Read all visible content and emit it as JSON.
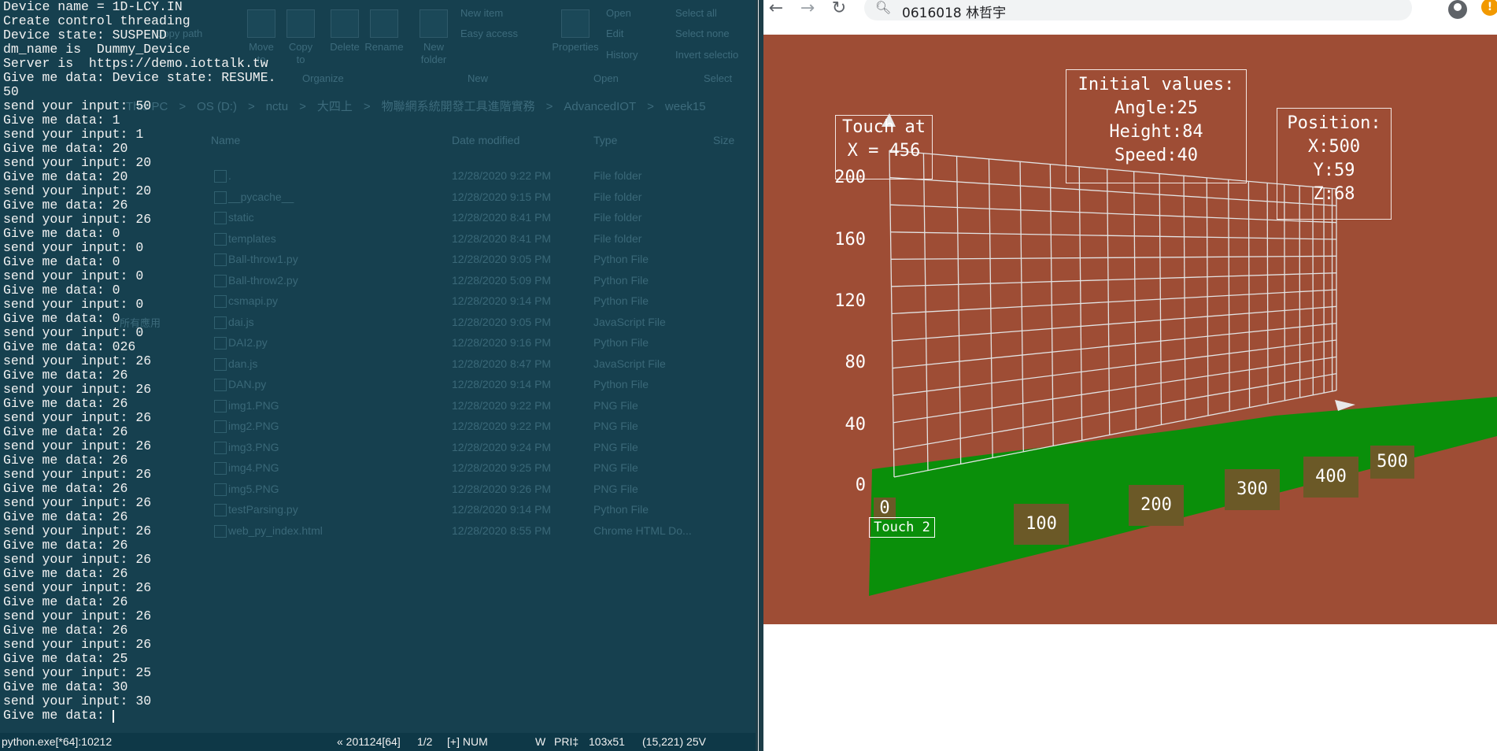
{
  "console": {
    "lines": [
      "Device name = 1D-LCY.IN",
      "Create control threading",
      "Device state: SUSPEND",
      "dm_name is  Dummy_Device",
      "Server is  https://demo.iottalk.tw",
      "Give me data: Device state: RESUME.",
      "50",
      "send your input: 50",
      "Give me data: 1",
      "send your input: 1",
      "Give me data: 20",
      "send your input: 20",
      "Give me data: 20",
      "send your input: 20",
      "Give me data: 26",
      "send your input: 26",
      "Give me data: 0",
      "send your input: 0",
      "Give me data: 0",
      "send your input: 0",
      "Give me data: 0",
      "send your input: 0",
      "Give me data: 0",
      "send your input: 0",
      "Give me data: 026",
      "send your input: 26",
      "Give me data: 26",
      "send your input: 26",
      "Give me data: 26",
      "send your input: 26",
      "Give me data: 26",
      "send your input: 26",
      "Give me data: 26",
      "send your input: 26",
      "Give me data: 26",
      "send your input: 26",
      "Give me data: 26",
      "send your input: 26",
      "Give me data: 26",
      "send your input: 26",
      "Give me data: 26",
      "send your input: 26",
      "Give me data: 26",
      "send your input: 26",
      "Give me data: 26",
      "send your input: 26",
      "Give me data: 25",
      "send your input: 25",
      "Give me data: 30",
      "send your input: 30",
      "Give me data: "
    ],
    "status": {
      "process": "python.exe[*64]:10212",
      "session": "« 201124[64]",
      "tabs": "1/2",
      "mode": "[+] NUM",
      "w": "W",
      "pri": "PRI‡",
      "size": "103x51",
      "cursor": "(15,221) 25V"
    }
  },
  "explorer": {
    "ribbon": {
      "move_to": "Move to",
      "copy_to": "Copy to",
      "delete": "Delete",
      "rename": "Rename",
      "new_folder": "New folder",
      "new_item": "New item",
      "easy_access": "Easy access",
      "properties": "Properties",
      "open": "Open",
      "edit": "Edit",
      "history": "History",
      "select_all": "Select all",
      "select_none": "Select none",
      "invert_selection": "Invert selectio",
      "copy_path": "Copy path",
      "groups": {
        "organize": "Organize",
        "new": "New",
        "open": "Open",
        "select": "Select"
      }
    },
    "breadcrumb": [
      "This PC",
      "OS (D:)",
      "nctu",
      "大四上",
      "物聯網系統開發工具進階實務",
      "AdvancedIOT",
      "week15"
    ],
    "columns": {
      "name": "Name",
      "date": "Date modified",
      "type": "Type",
      "size": "Size"
    },
    "files": [
      {
        "name": ".",
        "date": "12/28/2020 9:22 PM",
        "type": "File folder"
      },
      {
        "name": "__pycache__",
        "date": "12/28/2020 9:15 PM",
        "type": "File folder"
      },
      {
        "name": "static",
        "date": "12/28/2020 8:41 PM",
        "type": "File folder"
      },
      {
        "name": "templates",
        "date": "12/28/2020 8:41 PM",
        "type": "File folder"
      },
      {
        "name": "Ball-throw1.py",
        "date": "12/28/2020 9:05 PM",
        "type": "Python File"
      },
      {
        "name": "Ball-throw2.py",
        "date": "12/28/2020 5:09 PM",
        "type": "Python File"
      },
      {
        "name": "csmapi.py",
        "date": "12/28/2020 9:14 PM",
        "type": "Python File"
      },
      {
        "name": "dai.js",
        "date": "12/28/2020 9:05 PM",
        "type": "JavaScript File"
      },
      {
        "name": "DAI2.py",
        "date": "12/28/2020 9:16 PM",
        "type": "Python File"
      },
      {
        "name": "dan.js",
        "date": "12/28/2020 8:47 PM",
        "type": "JavaScript File"
      },
      {
        "name": "DAN.py",
        "date": "12/28/2020 9:14 PM",
        "type": "Python File"
      },
      {
        "name": "img1.PNG",
        "date": "12/28/2020 9:22 PM",
        "type": "PNG File"
      },
      {
        "name": "img2.PNG",
        "date": "12/28/2020 9:22 PM",
        "type": "PNG File"
      },
      {
        "name": "img3.PNG",
        "date": "12/28/2020 9:24 PM",
        "type": "PNG File"
      },
      {
        "name": "img4.PNG",
        "date": "12/28/2020 9:25 PM",
        "type": "PNG File"
      },
      {
        "name": "img5.PNG",
        "date": "12/28/2020 9:26 PM",
        "type": "PNG File"
      },
      {
        "name": "testParsing.py",
        "date": "12/28/2020 9:14 PM",
        "type": "Python File"
      },
      {
        "name": "web_py_index.html",
        "date": "12/28/2020 8:55 PM",
        "type": "Chrome HTML Do..."
      }
    ],
    "side_label": "所有應用"
  },
  "browser": {
    "url": "0616018 林哲宇",
    "alert_badge": "!",
    "scene": {
      "touch_panel": {
        "title": "Touch at",
        "value": "X = 456"
      },
      "initial_panel": {
        "title": "Initial values:",
        "angle": "Angle:25",
        "height": "Height:84",
        "speed": "Speed:40"
      },
      "position_panel": {
        "title": "Position:",
        "x": "X:500",
        "y": "Y:59",
        "z": "Z:68"
      },
      "y_ticks": [
        "200",
        "160",
        "120",
        "80",
        "40",
        "0"
      ],
      "x_ticks": [
        "100",
        "200",
        "300",
        "400",
        "500"
      ],
      "x_zero": "0",
      "touch2": "Touch 2",
      "colors": {
        "background": "#9e4d35",
        "ground": "#0a8f0a",
        "label_bg": "#6b5927",
        "grid": "#e2e2e2"
      }
    }
  }
}
